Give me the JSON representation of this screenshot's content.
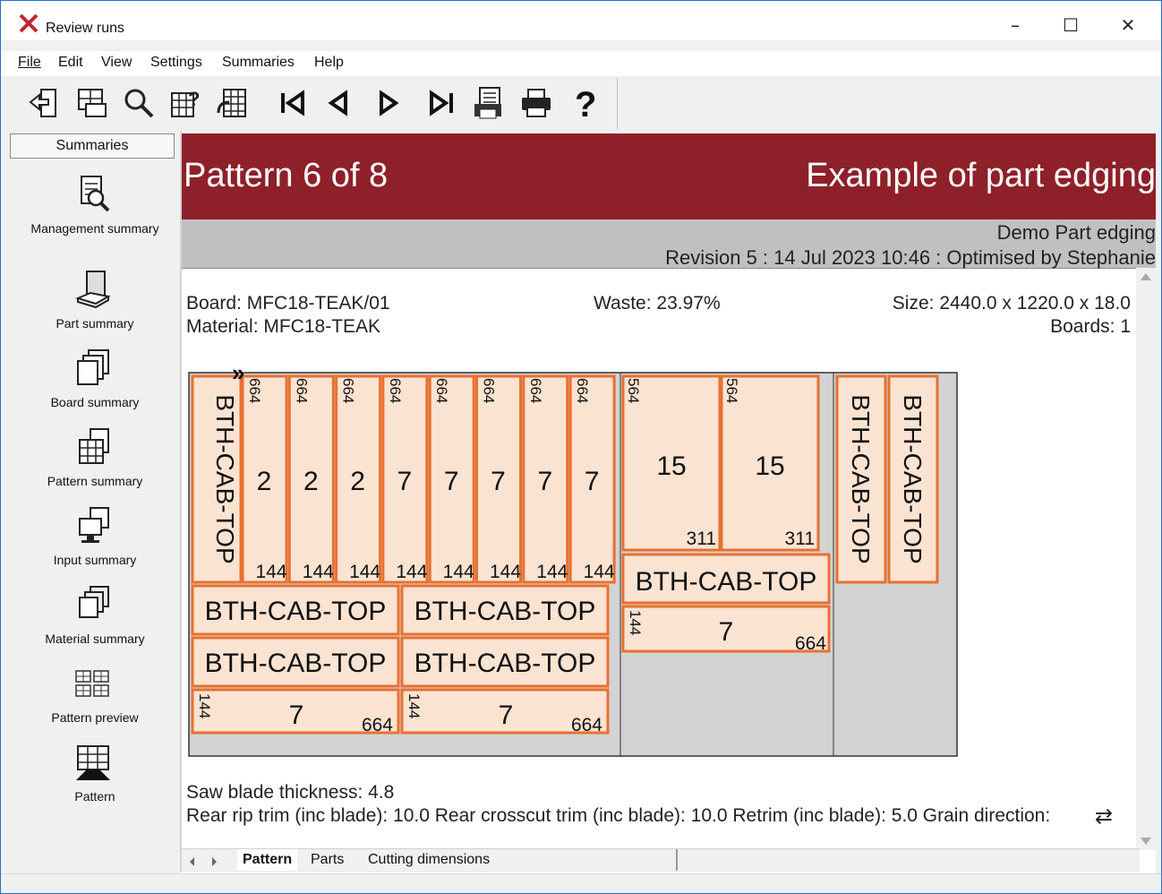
{
  "window": {
    "title": "Review runs",
    "minimize": "–",
    "maximize": "☐",
    "close": "✕"
  },
  "menu": [
    "File",
    "Edit",
    "View",
    "Settings",
    "Summaries",
    "Help"
  ],
  "toolbar": {
    "buttons": [
      "exit-icon",
      "ab-display-icon",
      "search-icon",
      "help-grid-icon",
      "grid-refresh-icon",
      "first-icon",
      "previous-icon",
      "next-icon",
      "last-icon",
      "print-preview-icon",
      "print-icon",
      "help-icon"
    ]
  },
  "sidebar": {
    "header": "Summaries",
    "items": [
      {
        "label": "Management summary",
        "icon": "management-icon"
      },
      {
        "label": "Part summary",
        "icon": "part-icon"
      },
      {
        "label": "Board summary",
        "icon": "board-icon"
      },
      {
        "label": "Pattern summary",
        "icon": "pattern-grid-icon"
      },
      {
        "label": "Input summary",
        "icon": "input-icon"
      },
      {
        "label": "Material summary",
        "icon": "material-icon"
      },
      {
        "label": "Pattern preview",
        "icon": "preview-icon"
      },
      {
        "label": "Pattern",
        "icon": "pattern-icon"
      }
    ]
  },
  "banner": {
    "left": "Pattern 6 of 8",
    "right": "Example of part edging"
  },
  "header": {
    "job": "Demo Part edging",
    "revision": "Revision 5 : 14 Jul 2023 10:46 : Optimised by Stephanie"
  },
  "board_info": {
    "board": "Board: MFC18-TEAK/01",
    "material": "Material: MFC18-TEAK",
    "waste": "Waste: 23.97%",
    "size": "Size: 2440.0 x 1220.0 x  18.0",
    "boards": "Boards: 1"
  },
  "footer": {
    "saw": "Saw blade thickness: 4.8",
    "trims": "Rear rip trim (inc blade): 10.0 Rear crosscut trim (inc blade): 10.0 Retrim (inc blade): 5.0 Grain direction:",
    "grain_symbol": "⇄"
  },
  "diagram": {
    "label_long": "BTH-CAB-TOP",
    "marker": "»",
    "strip_top": "664",
    "strip_bottom": "144",
    "strip_ids": [
      "2",
      "2",
      "2",
      "7",
      "7",
      "7",
      "7",
      "7"
    ],
    "big_id": "15",
    "big_dim_top": "564",
    "big_dim_bottom": "311",
    "small_id": "7",
    "small_left": "144",
    "small_right": "664"
  },
  "tabs": [
    "Pattern",
    "Parts",
    "Cutting dimensions"
  ],
  "colors": {
    "banner": "#8e2029",
    "part_fill": "#fbe3d2",
    "part_edge": "#e8702f",
    "waste": "#d3d3d3"
  }
}
